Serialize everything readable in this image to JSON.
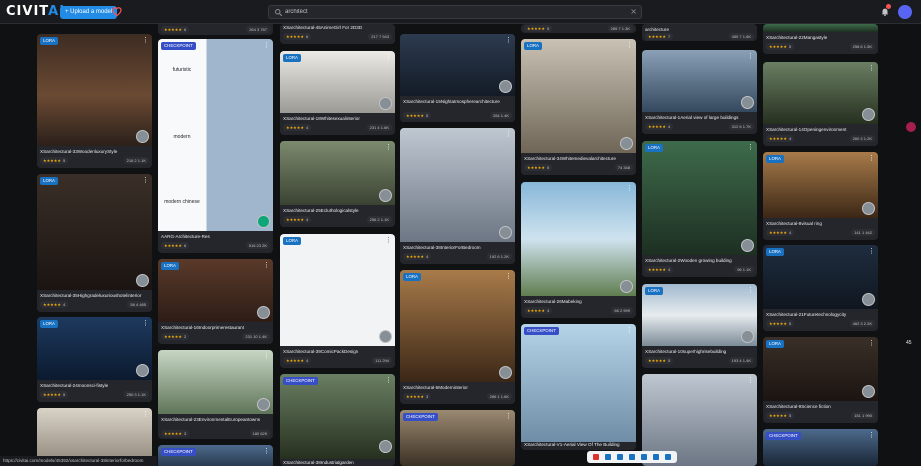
{
  "header": {
    "logo_main": "CIVIT",
    "logo_accent": "AI",
    "upload_label": "+ Upload a model",
    "search_value": "architect",
    "search_clear": "×"
  },
  "top_strips": [
    {
      "rating": "★★★★★",
      "num": "6",
      "counts": "264  3  787"
    },
    {
      "title": "XSarchitectural-45AnimeGirl For 2D3D",
      "rating": "★★★★★",
      "num": "6",
      "counts": "217  7  543"
    },
    {
      "rating": "★★★★★",
      "num": "5",
      "counts": "285  7  1.3K"
    },
    {
      "title": "architecture",
      "rating": "★★★★★",
      "num": "7",
      "counts": "455  7  1.6K"
    },
    {
      "title": "XSarchitectural-22Mangastyle",
      "rating": "★★★★★",
      "num": "5",
      "counts": "258  6  1.5K"
    }
  ],
  "cards": [
    {
      "badge": "LORA",
      "title": "XSarchitectural-33WoodenluxuryStyle",
      "num": "5",
      "counts": "216  2  1.1K"
    },
    {
      "badge": "LORA",
      "title": "XSarchitectural-35Highgradeluxurioushotelinterior",
      "num": "4",
      "counts": "56  4  485"
    },
    {
      "badge": "LORA",
      "title": "XSarchitectural-24moonsci-fistyle",
      "num": "5",
      "counts": "250  3  1.1K"
    },
    {
      "badge": "LORA",
      "title": "",
      "num": "",
      "counts": ""
    },
    {
      "badge": "CHECKPOINT",
      "title": "AARG-Architecture-Res",
      "num": "6",
      "counts": "516  23  2K",
      "labels": [
        "futuristic",
        "modern",
        "modern chinese"
      ]
    },
    {
      "badge": "LORA",
      "title": "XSarchitectural-16Indoorprimerestaurant",
      "num": "2",
      "counts": "231  10  1.4K"
    },
    {
      "badge": "LORA",
      "title": "XSarchitectural-23EnvironmentalEuropeantowns",
      "num": "3",
      "counts": "180  629"
    },
    {
      "badge": "CHECKPOINT",
      "title": "",
      "num": "",
      "counts": ""
    },
    {
      "badge": "LORA",
      "title": "XSarchitectural-18Whitesexualinterior",
      "num": "4",
      "counts": "231  4  1.6K"
    },
    {
      "badge": "LORA",
      "title": "XSarchitectural-25Ecluthologicalstyle",
      "num": "4",
      "counts": "256  2  1.1K"
    },
    {
      "badge": "LORA",
      "title": "XSarchitectural-39ComicPackDesign",
      "num": "4",
      "counts": "111  294"
    },
    {
      "badge": "CHECKPOINT",
      "title": "XSarchitectural-38Industrialgarden",
      "num": "",
      "counts": ""
    },
    {
      "badge": "LORA",
      "title": "XSarchitectural-15Nightatmospherearchitecture",
      "num": "5",
      "counts": "264  1.4K"
    },
    {
      "badge": "LORA",
      "title": "XSarchitectural-38InteriorForBedroom",
      "num": "4",
      "counts": "192  6  1.2K"
    },
    {
      "badge": "LORA",
      "title": "XSarchitectural-5Moderninterior",
      "num": "3",
      "counts": "286  1  1.6K"
    },
    {
      "badge": "CHECKPOINT",
      "title": "",
      "num": "",
      "counts": ""
    },
    {
      "badge": "LORA",
      "title": "XSarchitectural-34Whitemedievalarchitecture",
      "num": "5",
      "counts": "74  348"
    },
    {
      "badge": "LORA",
      "title": "XSarchitectural-26Mabeking",
      "num": "4",
      "counts": "66  2  599"
    },
    {
      "badge": "CHECKPOINT",
      "title": "XSarchitectural-V1-Aerial View Of The Building",
      "num": "",
      "counts": ""
    },
    {
      "badge": "LORA",
      "title": "XSarchitectural-1Aerial view of large buildings",
      "num": "4",
      "counts": "312  6  1.7K"
    },
    {
      "badge": "LORA",
      "title": "XSarchitectural-2Wooden growing building",
      "num": "4",
      "counts": "96  1.1K"
    },
    {
      "badge": "LORA",
      "title": "XSarchitectural-10superhighrisebuilding",
      "num": "5",
      "counts": "193  4  1.4K"
    },
    {
      "badge": "LORA",
      "title": "",
      "num": "",
      "counts": ""
    },
    {
      "badge": "LORA",
      "title": "XSarchitectural-14Openingenvironment",
      "num": "4",
      "counts": "260  3  1.2K"
    },
    {
      "badge": "LORA",
      "title": "XSarchitectural-8visual ring",
      "num": "4",
      "counts": "141  1  442"
    },
    {
      "badge": "LORA",
      "title": "XSarchitectural-21Futuretechnologycity",
      "num": "5",
      "counts": "462  3  2.2K"
    },
    {
      "badge": "LORA",
      "title": "XSarchitectural-9Science fiction",
      "num": "5",
      "counts": "151  1  990"
    },
    {
      "badge": "CHECKPOINT",
      "title": "",
      "num": "",
      "counts": ""
    }
  ],
  "status_url": "https://civitai.com/models/45392/xsarchitectural-38interiorforbedroom",
  "side_number": "45",
  "stars": "★★★★★",
  "menu_glyph": "⋮",
  "icons": [
    "heart-icon",
    "search-icon",
    "bell-icon",
    "menu-dots-icon"
  ],
  "colors": {
    "accent": "#228be6",
    "lora_badge": "#1971c2",
    "checkpoint_badge": "#364fc7",
    "star": "#fab005"
  }
}
